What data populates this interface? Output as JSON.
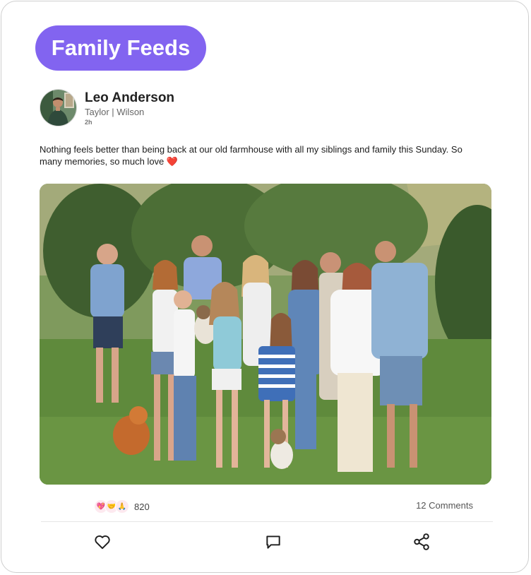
{
  "header": {
    "title": "Family Feeds"
  },
  "post": {
    "author_name": "Leo Anderson",
    "author_sub": "Taylor | Wilson",
    "time": "2h",
    "text": "Nothing feels better than being back at our old farmhouse with all my siblings and family this Sunday. So many memories, so much love",
    "text_emoji": "❤️"
  },
  "engagement": {
    "reaction_icons": [
      "sparkling-heart-icon",
      "handshake-icon",
      "pray-icon"
    ],
    "reaction_count": "820",
    "comments": "12 Comments"
  },
  "actions": [
    "like-icon",
    "comment-icon",
    "share-icon"
  ],
  "colors": {
    "accent": "#8264f0",
    "heart": "#e53935"
  }
}
